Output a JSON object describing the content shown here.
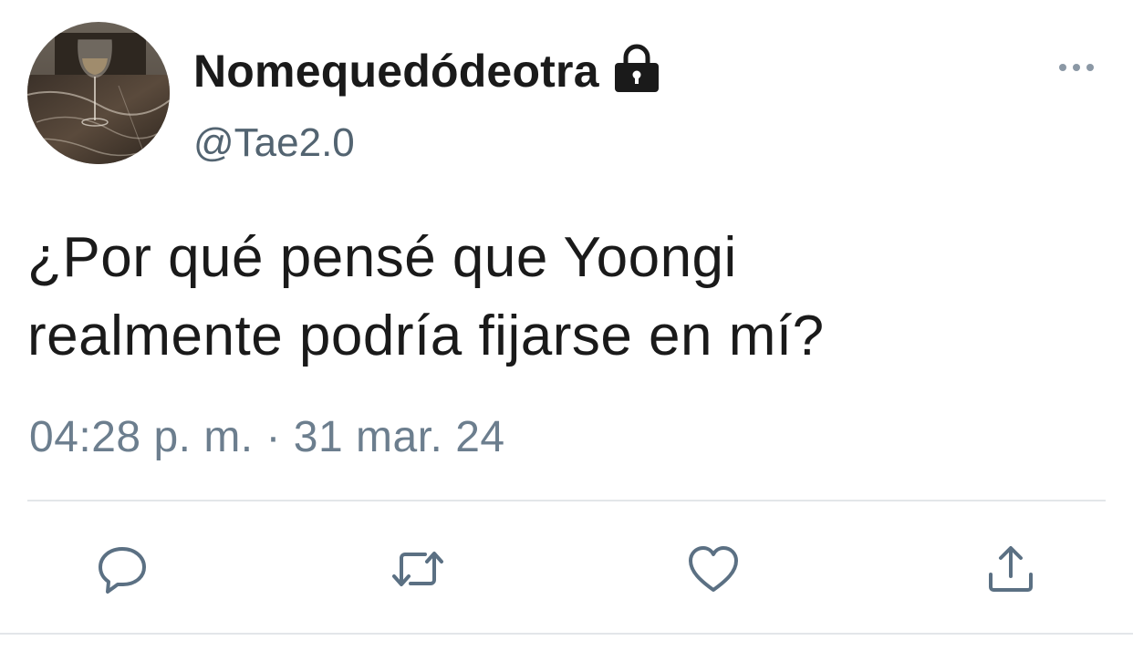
{
  "author": {
    "display_name": "Nomequedódeotra",
    "handle": "@Tae2.0",
    "protected_icon": "lock-icon",
    "avatar": "wine-glass-photo"
  },
  "tweet": {
    "text_lines": [
      "¿Por qué pensé que Yoongi",
      "realmente podría fijarse en mí?"
    ],
    "timestamp": "04:28 p. m. · 31 mar. 24"
  },
  "menu": {
    "icon": "more-horizontal-icon"
  },
  "actions": [
    {
      "name": "reply",
      "icon": "reply-icon"
    },
    {
      "name": "retweet",
      "icon": "retweet-icon"
    },
    {
      "name": "like",
      "icon": "heart-icon"
    },
    {
      "name": "share",
      "icon": "share-icon"
    }
  ],
  "colors": {
    "text_primary": "#1a1a1a",
    "text_secondary": "#536471",
    "timestamp": "#6c7e8e",
    "icon": "#5b7083",
    "divider": "#e3e6e9"
  }
}
